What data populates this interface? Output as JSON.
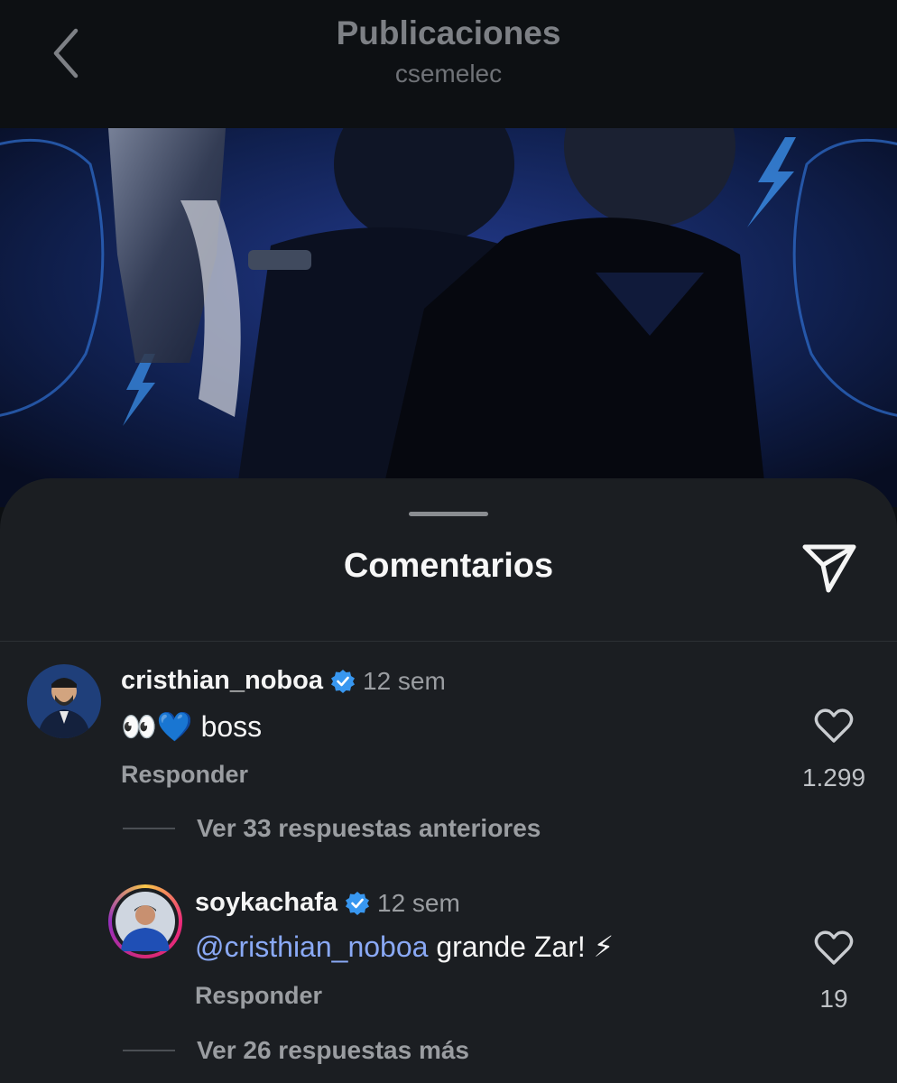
{
  "header": {
    "title": "Publicaciones",
    "subtitle": "csemelec",
    "back_icon": "chevron-left-icon"
  },
  "sheet": {
    "title": "Comentarios",
    "share_icon": "paper-plane-icon"
  },
  "comments": [
    {
      "username": "cristhian_noboa",
      "verified": true,
      "time": "12 sem",
      "text": "👀💙 boss",
      "reply_label": "Responder",
      "likes": "1.299",
      "view_replies": "Ver 33 respuestas anteriores"
    },
    {
      "username": "soykachafa",
      "verified": true,
      "time": "12 sem",
      "mention": "@cristhian_noboa",
      "text": "grande Zar! ⚡",
      "reply_label": "Responder",
      "likes": "19",
      "view_replies": "Ver 26 respuestas más"
    }
  ],
  "colors": {
    "background": "#0c0f12",
    "sheet": "#1b1e22",
    "mention": "#8aa9f5",
    "verified": "#3897f0"
  }
}
